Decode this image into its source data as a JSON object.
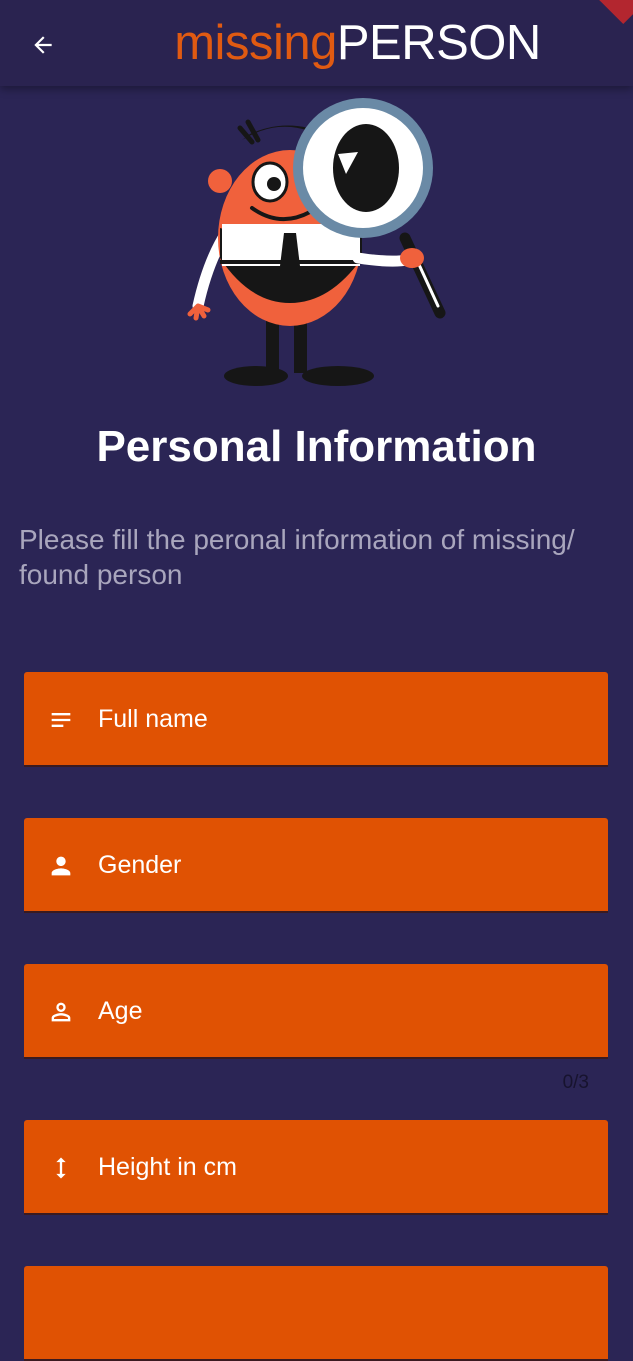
{
  "appbar": {
    "back_icon": "arrow-back-icon",
    "brand_prefix": "missing",
    "brand_suffix": "PERSON"
  },
  "content": {
    "title": "Personal Information",
    "subtitle": "Please fill the peronal information of missing/ found person"
  },
  "fields": [
    {
      "label": "Full name",
      "icon": "subject-lines-icon"
    },
    {
      "label": "Gender",
      "icon": "person-filled-icon"
    },
    {
      "label": "Age",
      "icon": "person-outline-icon",
      "counter": "0/3"
    },
    {
      "label": "Height in cm",
      "icon": "vertical-arrows-icon"
    }
  ],
  "colors": {
    "background": "#2b2555",
    "appbar": "#2a2350",
    "accent": "#e05203",
    "brand_orange": "#e05a12"
  }
}
